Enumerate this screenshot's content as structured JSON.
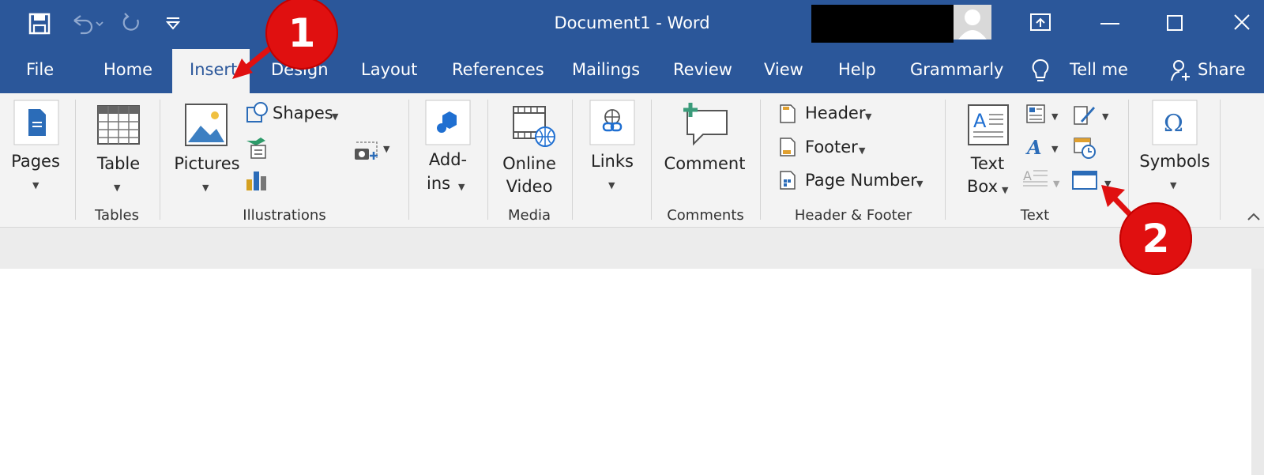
{
  "window": {
    "title": "Document1  -  Word"
  },
  "qat": {
    "icons": [
      "save-icon",
      "undo-icon",
      "redo-icon",
      "customize-qat-icon"
    ]
  },
  "tabs": [
    {
      "label": "File"
    },
    {
      "label": "Home"
    },
    {
      "label": "Insert",
      "active": true
    },
    {
      "label": "Design"
    },
    {
      "label": "Layout"
    },
    {
      "label": "References"
    },
    {
      "label": "Mailings"
    },
    {
      "label": "Review"
    },
    {
      "label": "View"
    },
    {
      "label": "Help"
    },
    {
      "label": "Grammarly"
    }
  ],
  "tell_me": {
    "label": "Tell me"
  },
  "share": {
    "label": "Share"
  },
  "ribbon": {
    "pages": {
      "label": "Pages"
    },
    "table": {
      "label": "Table",
      "group": "Tables"
    },
    "illustrations": {
      "pictures": "Pictures",
      "shapes": "Shapes",
      "group": "Illustrations"
    },
    "addins": {
      "line1": "Add-",
      "line2": "ins"
    },
    "media": {
      "line1": "Online",
      "line2": "Video",
      "group": "Media"
    },
    "links": {
      "label": "Links"
    },
    "comments": {
      "label": "Comment",
      "group": "Comments"
    },
    "header_footer": {
      "header": "Header",
      "footer": "Footer",
      "page_number": "Page Number",
      "group": "Header & Footer"
    },
    "text": {
      "line1": "Text",
      "line2": "Box",
      "group": "Text"
    },
    "symbols": {
      "label": "Symbols"
    }
  },
  "annotations": {
    "callout1": "1",
    "callout2": "2",
    "color": "#e01010"
  },
  "colors": {
    "brand": "#2b579a",
    "ribbon_bg": "#f3f3f3"
  }
}
